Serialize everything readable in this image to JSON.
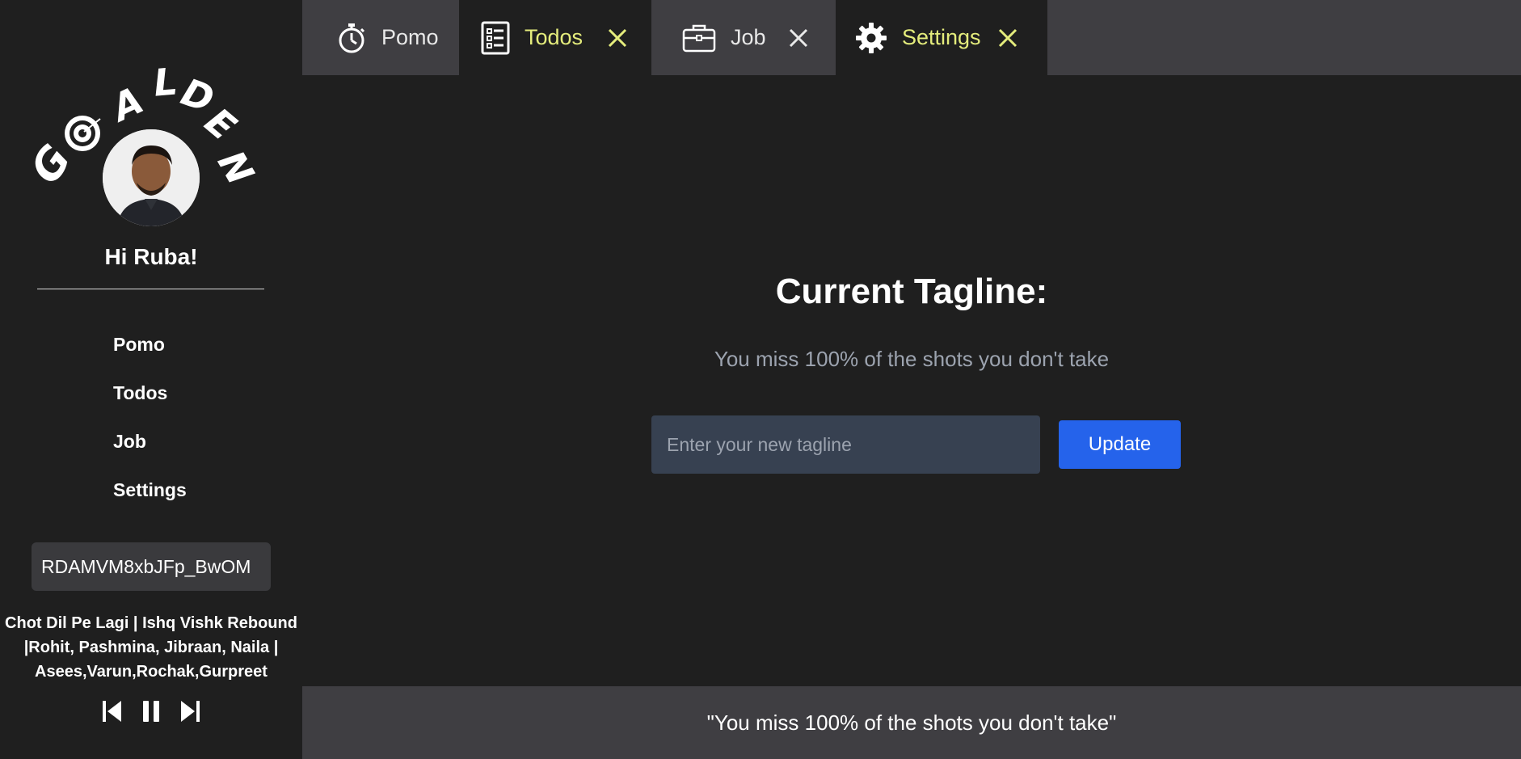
{
  "app": {
    "logo_text": "GOALDEN"
  },
  "sidebar": {
    "greeting": "Hi Ruba!",
    "nav": [
      {
        "label": "Pomo"
      },
      {
        "label": "Todos"
      },
      {
        "label": "Job"
      },
      {
        "label": "Settings"
      }
    ],
    "video_id": "RDAMVM8xbJFp_BwOM",
    "song_title_lines": [
      "Chot Dil Pe Lagi | Ishq Vishk Rebound",
      "|Rohit, Pashmina, Jibraan, Naila |",
      "Asees,Varun,Rochak,Gurpreet"
    ],
    "player": {
      "prev_icon": "skip-previous-icon",
      "pause_icon": "pause-icon",
      "next_icon": "skip-next-icon"
    }
  },
  "tabs": [
    {
      "label": "Pomo",
      "icon": "stopwatch-icon",
      "closable": false,
      "active": false
    },
    {
      "label": "Todos",
      "icon": "checklist-icon",
      "closable": true,
      "active": true
    },
    {
      "label": "Job",
      "icon": "briefcase-icon",
      "closable": true,
      "active": false
    },
    {
      "label": "Settings",
      "icon": "gear-icon",
      "closable": true,
      "active": true
    }
  ],
  "main": {
    "title": "Current Tagline:",
    "current_tagline": "You miss 100% of the shots you don't take",
    "input_placeholder": "Enter your new tagline",
    "update_label": "Update"
  },
  "footer": {
    "quote": "\"You miss 100% of the shots you don't take\""
  },
  "colors": {
    "accent_yellow": "#e4ec7c",
    "button_blue": "#2563eb",
    "tab_gray": "#3f3e42",
    "bg": "#1f1f1f"
  }
}
